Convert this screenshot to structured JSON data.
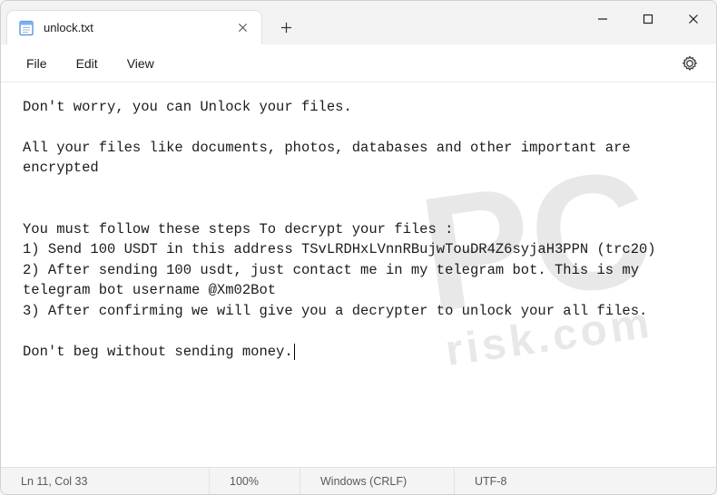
{
  "titlebar": {
    "tab_label": "unlock.txt"
  },
  "menu": {
    "file": "File",
    "edit": "Edit",
    "view": "View"
  },
  "content": {
    "text": "Don't worry, you can Unlock your files.\n\nAll your files like documents, photos, databases and other important are encrypted\n\n\nYou must follow these steps To decrypt your files :\n1) Send 100 USDT in this address TSvLRDHxLVnnRBujwTouDR4Z6syjaH3PPN (trc20)\n2) After sending 100 usdt, just contact me in my telegram bot. This is my telegram bot username @Xm02Bot\n3) After confirming we will give you a decrypter to unlock your all files.\n\nDon't beg without sending money."
  },
  "status": {
    "position": "Ln 11, Col 33",
    "zoom": "100%",
    "eol": "Windows (CRLF)",
    "encoding": "UTF-8"
  },
  "watermark": {
    "big": "PC",
    "text": "risk.com"
  }
}
